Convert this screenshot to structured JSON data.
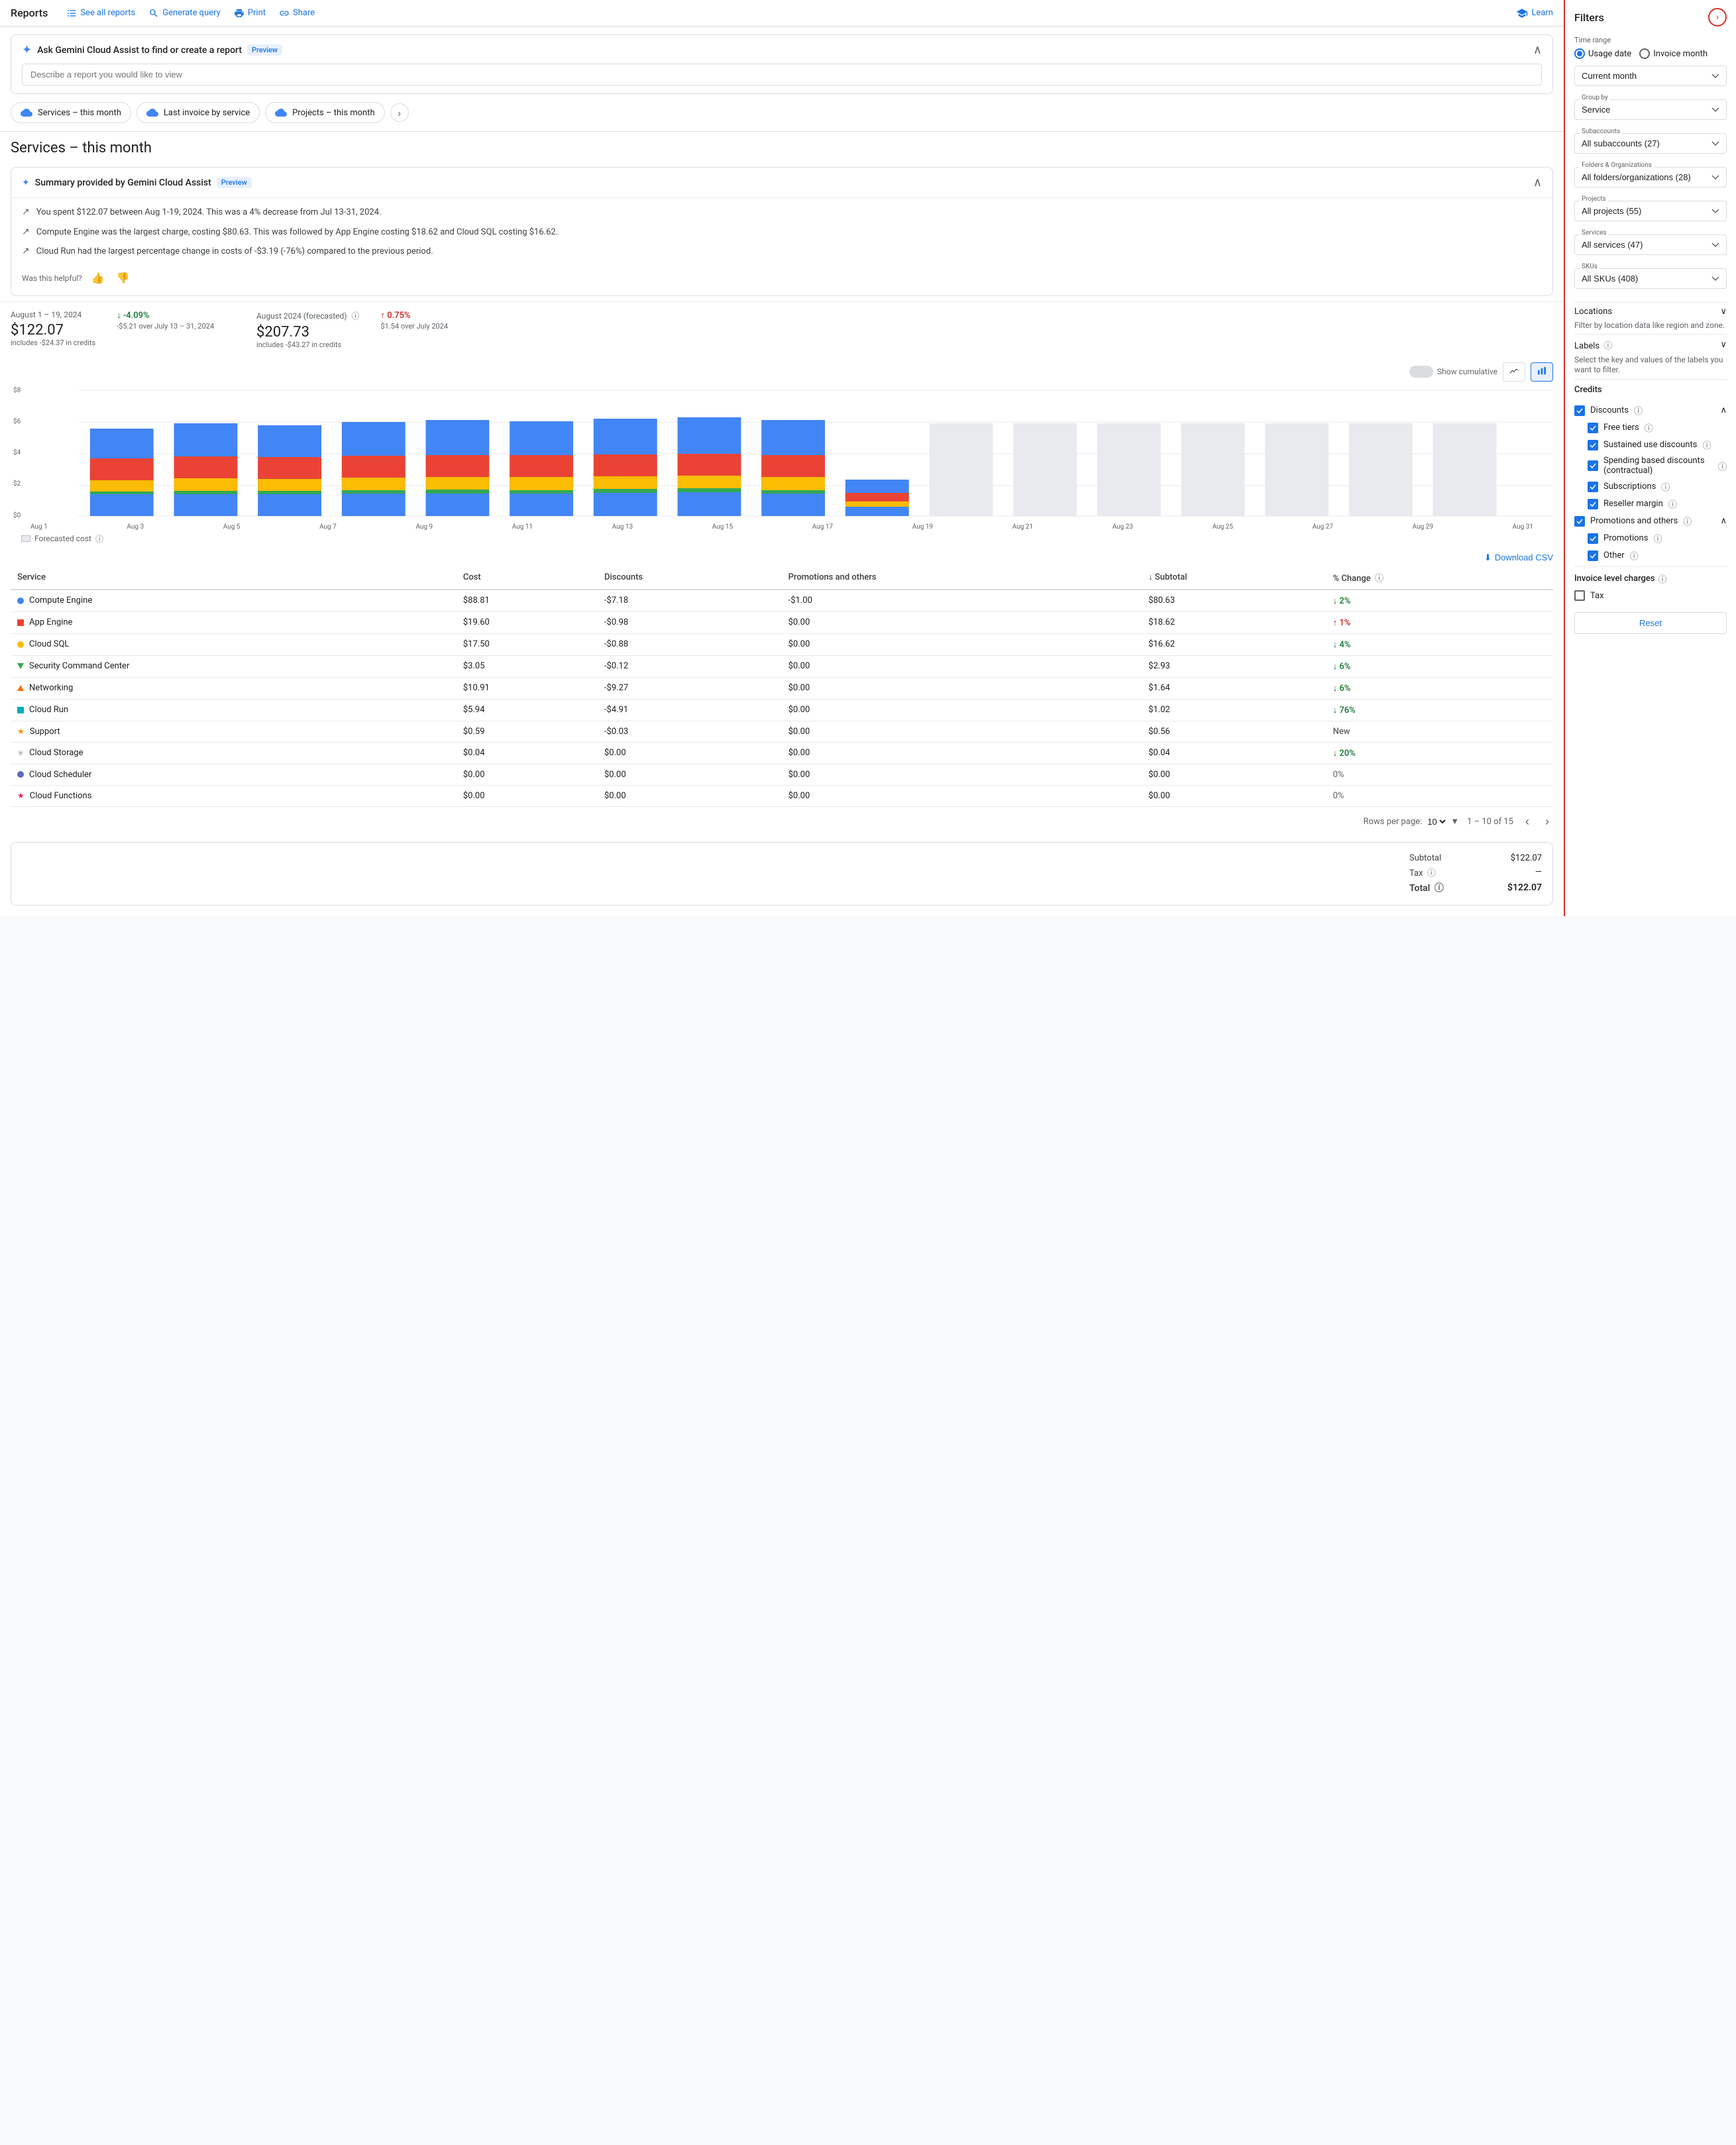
{
  "topnav": {
    "brand": "Reports",
    "links": [
      {
        "label": "See all reports",
        "icon": "list-icon"
      },
      {
        "label": "Generate query",
        "icon": "search-icon"
      },
      {
        "label": "Print",
        "icon": "print-icon"
      },
      {
        "label": "Share",
        "icon": "share-icon"
      }
    ],
    "learn_label": "Learn",
    "learn_icon": "graduation-icon"
  },
  "gemini": {
    "title": "Ask Gemini Cloud Assist to find or create a report",
    "preview_badge": "Preview",
    "input_placeholder": "Describe a report you would like to view"
  },
  "report_chips": [
    {
      "label": "Services – this month"
    },
    {
      "label": "Last invoice by service"
    },
    {
      "label": "Projects – this month"
    }
  ],
  "section_title": "Services – this month",
  "summary_card": {
    "title": "Summary provided by Gemini Cloud Assist",
    "preview_badge": "Preview",
    "items": [
      "You spent $122.07 between Aug 1-19, 2024. This was a 4% decrease from Jul 13-31, 2024.",
      "Compute Engine was the largest charge, costing $80.63. This was followed by App Engine costing $18.62 and Cloud SQL costing $16.62.",
      "Cloud Run had the largest percentage change in costs of -$3.19 (-76%) compared to the previous period."
    ],
    "helpful_label": "Was this helpful?"
  },
  "stats": {
    "period1": {
      "date": "August 1 – 19, 2024",
      "amount": "$122.07",
      "sub": "includes -$24.37 in credits",
      "change": "↓ -4.09%",
      "change_type": "down",
      "change_sub": "-$5.21 over July 13 – 31, 2024"
    },
    "period2": {
      "date": "August 2024 (forecasted)",
      "amount": "$207.73",
      "sub": "includes -$43.27 in credits",
      "change": "↑ 0.75%",
      "change_type": "up",
      "change_sub": "$1.54 over July 2024"
    }
  },
  "chart": {
    "show_cumulative_label": "Show cumulative",
    "y_labels": [
      "$8",
      "$6",
      "$4",
      "$2",
      "$0"
    ],
    "x_labels": [
      "Aug 1",
      "Aug 3",
      "Aug 5",
      "Aug 7",
      "Aug 9",
      "Aug 11",
      "Aug 13",
      "Aug 15",
      "Aug 17",
      "Aug 19",
      "Aug 21",
      "Aug 23",
      "Aug 25",
      "Aug 27",
      "Aug 29",
      "Aug 31"
    ],
    "bars": [
      {
        "actual": true,
        "blue": 65,
        "orange": 20,
        "red": 8
      },
      {
        "actual": true,
        "blue": 72,
        "orange": 22,
        "red": 10
      },
      {
        "actual": true,
        "blue": 70,
        "orange": 21,
        "red": 9
      },
      {
        "actual": true,
        "blue": 74,
        "orange": 23,
        "red": 10
      },
      {
        "actual": true,
        "blue": 76,
        "orange": 24,
        "red": 11
      },
      {
        "actual": true,
        "blue": 75,
        "orange": 24,
        "red": 10
      },
      {
        "actual": true,
        "blue": 77,
        "orange": 25,
        "red": 11
      },
      {
        "actual": true,
        "blue": 78,
        "orange": 25,
        "red": 11
      },
      {
        "actual": true,
        "blue": 75,
        "orange": 23,
        "red": 10
      },
      {
        "actual": true,
        "blue": 20,
        "orange": 8,
        "red": 4
      },
      {
        "actual": false,
        "blue": 72,
        "orange": 0,
        "red": 0
      },
      {
        "actual": false,
        "blue": 72,
        "orange": 0,
        "red": 0
      },
      {
        "actual": false,
        "blue": 72,
        "orange": 0,
        "red": 0
      },
      {
        "actual": false,
        "blue": 72,
        "orange": 0,
        "red": 0
      },
      {
        "actual": false,
        "blue": 72,
        "orange": 0,
        "red": 0
      },
      {
        "actual": false,
        "blue": 72,
        "orange": 0,
        "red": 0
      }
    ]
  },
  "forecast_legend": "Forecasted cost",
  "table": {
    "download_label": "Download CSV",
    "columns": [
      "Service",
      "Cost",
      "Discounts",
      "Promotions and others",
      "Subtotal",
      "% Change"
    ],
    "rows": [
      {
        "service": "Compute Engine",
        "color": "#4285f4",
        "shape": "circle",
        "cost": "$88.81",
        "discounts": "-$7.18",
        "promotions": "-$1.00",
        "subtotal": "$80.63",
        "pct": "↓ 2%",
        "pct_type": "down"
      },
      {
        "service": "App Engine",
        "color": "#ea4335",
        "shape": "square",
        "cost": "$19.60",
        "discounts": "-$0.98",
        "promotions": "$0.00",
        "subtotal": "$18.62",
        "pct": "↑ 1%",
        "pct_type": "up"
      },
      {
        "service": "Cloud SQL",
        "color": "#fbbc04",
        "shape": "circle",
        "cost": "$17.50",
        "discounts": "-$0.88",
        "promotions": "$0.00",
        "subtotal": "$16.62",
        "pct": "↓ 4%",
        "pct_type": "down"
      },
      {
        "service": "Security Command Center",
        "color": "#34a853",
        "shape": "triangle-down",
        "cost": "$3.05",
        "discounts": "-$0.12",
        "promotions": "$0.00",
        "subtotal": "$2.93",
        "pct": "↓ 6%",
        "pct_type": "down"
      },
      {
        "service": "Networking",
        "color": "#ff6d00",
        "shape": "triangle-up",
        "cost": "$10.91",
        "discounts": "-$9.27",
        "promotions": "$0.00",
        "subtotal": "$1.64",
        "pct": "↓ 6%",
        "pct_type": "down"
      },
      {
        "service": "Cloud Run",
        "color": "#00acc1",
        "shape": "square",
        "cost": "$5.94",
        "discounts": "-$4.91",
        "promotions": "$0.00",
        "subtotal": "$1.02",
        "pct": "↓ 76%",
        "pct_type": "down"
      },
      {
        "service": "Support",
        "color": "#ff8f00",
        "shape": "star",
        "cost": "$0.59",
        "discounts": "-$0.03",
        "promotions": "$0.00",
        "subtotal": "$0.56",
        "pct": "New",
        "pct_type": "new"
      },
      {
        "service": "Cloud Storage",
        "color": "#9e9e9e",
        "shape": "star-outline",
        "cost": "$0.04",
        "discounts": "$0.00",
        "promotions": "$0.00",
        "subtotal": "$0.04",
        "pct": "↓ 20%",
        "pct_type": "down"
      },
      {
        "service": "Cloud Scheduler",
        "color": "#5c6bc0",
        "shape": "circle",
        "cost": "$0.00",
        "discounts": "$0.00",
        "promotions": "$0.00",
        "subtotal": "$0.00",
        "pct": "0%",
        "pct_type": "zero"
      },
      {
        "service": "Cloud Functions",
        "color": "#e91e63",
        "shape": "star",
        "cost": "$0.00",
        "discounts": "$0.00",
        "promotions": "$0.00",
        "subtotal": "$0.00",
        "pct": "0%",
        "pct_type": "zero"
      }
    ],
    "pagination": {
      "rows_per_page": "10",
      "range": "1 – 10 of 15"
    }
  },
  "totals": {
    "subtotal_label": "Subtotal",
    "subtotal_value": "$122.07",
    "tax_label": "Tax",
    "tax_help": "?",
    "tax_value": "—",
    "total_label": "Total",
    "total_help": "?",
    "total_value": "$122.07"
  },
  "filters": {
    "title": "Filters",
    "time_range_label": "Time range",
    "usage_date_label": "Usage date",
    "invoice_month_label": "Invoice month",
    "current_month": "Current month",
    "group_by_label": "Group by",
    "group_by_value": "Service",
    "subaccounts_label": "Subaccounts",
    "subaccounts_value": "All subaccounts (27)",
    "folders_label": "Folders & Organizations",
    "folders_value": "All folders/organizations (28)",
    "projects_label": "Projects",
    "projects_value": "All projects (55)",
    "services_label": "Services",
    "services_value": "All services (47)",
    "skus_label": "SKUs",
    "skus_value": "All SKUs (408)",
    "locations_label": "Locations",
    "locations_desc": "Filter by location data like region and zone.",
    "labels_label": "Labels",
    "labels_desc": "Select the key and values of the labels you want to filter.",
    "credits": {
      "title": "Credits",
      "discounts": {
        "label": "Discounts",
        "checked": true
      },
      "free_tiers": {
        "label": "Free tiers",
        "checked": true
      },
      "sustained_use": {
        "label": "Sustained use discounts",
        "checked": true
      },
      "spending_based": {
        "label": "Spending based discounts (contractual)",
        "checked": true
      },
      "subscriptions": {
        "label": "Subscriptions",
        "checked": true
      },
      "reseller_margin": {
        "label": "Reseller margin",
        "checked": true
      },
      "promotions_others": {
        "label": "Promotions and others",
        "checked": true
      },
      "promotions": {
        "label": "Promotions",
        "checked": true
      },
      "other": {
        "label": "Other",
        "checked": true
      }
    },
    "invoice_level": {
      "title": "Invoice level charges",
      "tax": {
        "label": "Tax",
        "checked": false
      }
    },
    "reset_label": "Reset"
  }
}
